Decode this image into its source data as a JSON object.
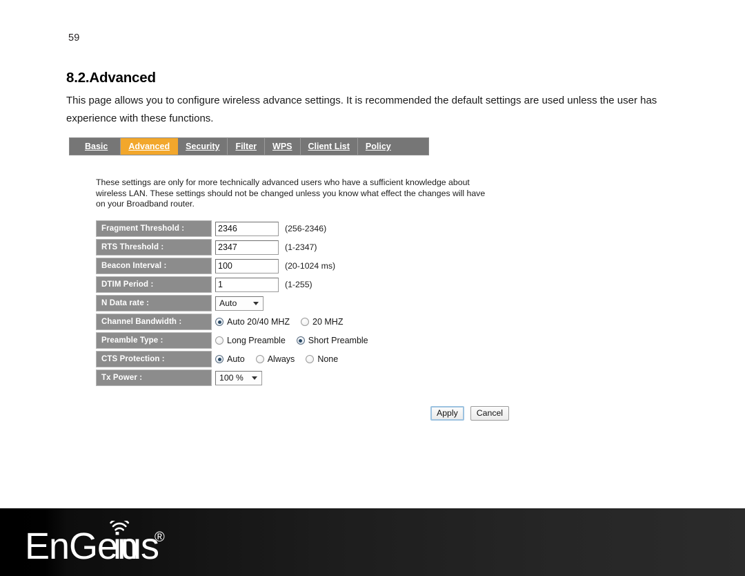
{
  "document": {
    "page_number": "59",
    "section_heading": "8.2.Advanced",
    "section_body": "This page allows you to configure wireless advance settings. It is recommended the default settings are used unless the user has experience with these functions."
  },
  "router_ui": {
    "tabs": [
      {
        "label": "Basic",
        "active": false
      },
      {
        "label": "Advanced",
        "active": true
      },
      {
        "label": "Security",
        "active": false
      },
      {
        "label": "Filter",
        "active": false
      },
      {
        "label": "WPS",
        "active": false
      },
      {
        "label": "Client List",
        "active": false
      },
      {
        "label": "Policy",
        "active": false
      }
    ],
    "panel_description": "These settings are only for more technically advanced users who have a sufficient knowledge about wireless LAN. These settings should not be changed unless you know what effect the changes will have on your Broadband router.",
    "fields": {
      "fragment_threshold": {
        "label": "Fragment Threshold :",
        "value": "2346",
        "hint": "(256-2346)"
      },
      "rts_threshold": {
        "label": "RTS Threshold :",
        "value": "2347",
        "hint": "(1-2347)"
      },
      "beacon_interval": {
        "label": "Beacon Interval :",
        "value": "100",
        "hint": "(20-1024 ms)"
      },
      "dtim_period": {
        "label": "DTIM Period :",
        "value": "1",
        "hint": "(1-255)"
      },
      "n_data_rate": {
        "label": "N Data rate :",
        "selected": "Auto",
        "options": [
          "Auto"
        ]
      },
      "channel_bandwidth": {
        "label": "Channel Bandwidth :",
        "options": [
          {
            "label": "Auto 20/40 MHZ",
            "checked": true
          },
          {
            "label": "20 MHZ",
            "checked": false
          }
        ]
      },
      "preamble_type": {
        "label": "Preamble Type :",
        "options": [
          {
            "label": "Long Preamble",
            "checked": false
          },
          {
            "label": "Short Preamble",
            "checked": true
          }
        ]
      },
      "cts_protection": {
        "label": "CTS Protection :",
        "options": [
          {
            "label": "Auto",
            "checked": true
          },
          {
            "label": "Always",
            "checked": false
          },
          {
            "label": "None",
            "checked": false
          }
        ]
      },
      "tx_power": {
        "label": "Tx Power :",
        "selected": "100 %",
        "options": [
          "100 %"
        ]
      }
    },
    "buttons": {
      "apply": "Apply",
      "cancel": "Cancel"
    }
  },
  "footer": {
    "brand": "EnGenius",
    "registered_mark": "®"
  },
  "colors": {
    "tab_bar": "#767676",
    "tab_active": "#f2a72c",
    "row_label": "#8c8c8c",
    "footer": "#1a1a1a"
  }
}
